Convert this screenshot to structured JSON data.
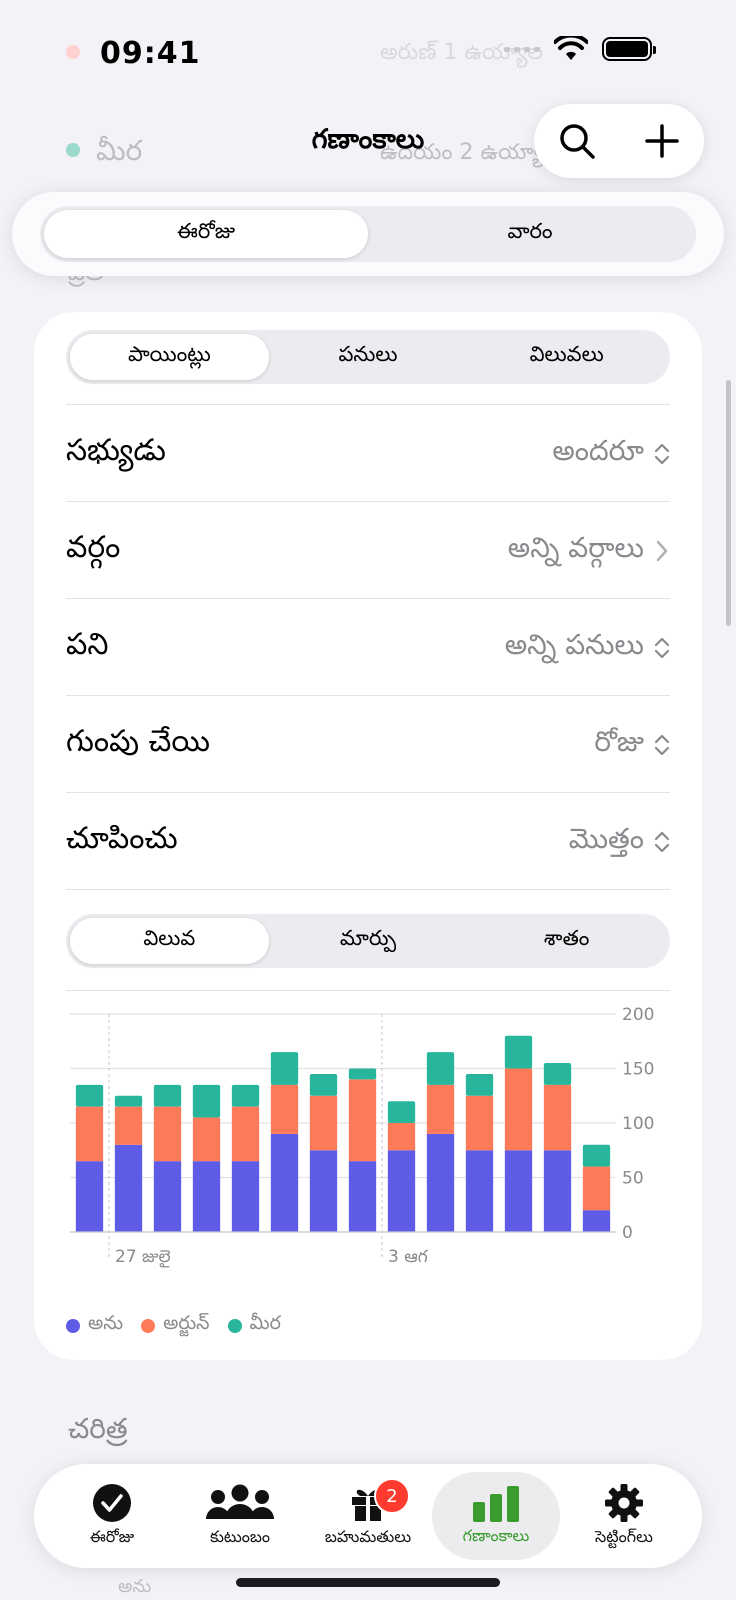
{
  "status": {
    "time": "09:41"
  },
  "background_list": {
    "row1_name": "అరుణ్ 1 ఉయ్యాల",
    "row2_name": "మీర",
    "row2_detail": "ఉదయం 2 ఉయ్యాల",
    "section_partial": "ప్రతి",
    "bottom_name": "అను"
  },
  "header": {
    "title": "గణాంకాలు",
    "search_icon": "search-icon",
    "add_icon": "plus-icon"
  },
  "period_tabs": [
    {
      "label": "ఈరోజు",
      "active": true
    },
    {
      "label": "వారం",
      "active": false
    }
  ],
  "metric_tabs": [
    {
      "label": "పాయింట్లు",
      "active": true
    },
    {
      "label": "పనులు",
      "active": false
    },
    {
      "label": "విలువలు",
      "active": false
    }
  ],
  "filters": [
    {
      "label": "సభ్యుడు",
      "value": "అందరూ",
      "control": "updown"
    },
    {
      "label": "వర్గం",
      "value": "అన్ని వర్గాలు",
      "control": "chevron"
    },
    {
      "label": "పని",
      "value": "అన్ని పనులు",
      "control": "updown"
    },
    {
      "label": "గుంపు చేయి",
      "value": "రోజు",
      "control": "updown"
    },
    {
      "label": "చూపించు",
      "value": "మొత్తం",
      "control": "updown"
    }
  ],
  "view_tabs": [
    {
      "label": "విలువ",
      "active": true
    },
    {
      "label": "మార్పు",
      "active": false
    },
    {
      "label": "శాతం",
      "active": false
    }
  ],
  "chart_data": {
    "type": "bar",
    "stacked": true,
    "categories": [
      "d1",
      "d2",
      "d3",
      "d4",
      "d5",
      "d6",
      "d7",
      "d8",
      "d9",
      "d10",
      "d11",
      "d12",
      "d13",
      "d14"
    ],
    "x_tick_labels": [
      {
        "index": 1,
        "label": "27 జులై"
      },
      {
        "index": 8,
        "label": "3 ఆగ"
      }
    ],
    "series": [
      {
        "name": "అను",
        "color": "#5e5ce6",
        "values": [
          65,
          80,
          65,
          65,
          65,
          90,
          75,
          65,
          75,
          90,
          75,
          75,
          75,
          20
        ]
      },
      {
        "name": "అర్జున్",
        "color": "#ff7a59",
        "values": [
          50,
          35,
          50,
          40,
          50,
          45,
          50,
          75,
          25,
          45,
          50,
          75,
          60,
          40
        ]
      },
      {
        "name": "మీర",
        "color": "#27b59b",
        "values": [
          20,
          10,
          20,
          30,
          20,
          30,
          20,
          10,
          20,
          30,
          20,
          30,
          20,
          20
        ]
      }
    ],
    "ylim": [
      0,
      200
    ],
    "yticks": [
      0,
      50,
      100,
      150,
      200
    ],
    "grid": true,
    "legend_position": "bottom-left"
  },
  "history": {
    "title": "చరిత్ర"
  },
  "tabbar": [
    {
      "label": "ఈరోజు",
      "icon": "checkmark-circle-icon",
      "active": false
    },
    {
      "label": "కుటుంబం",
      "icon": "people-icon",
      "active": false
    },
    {
      "label": "బహుమతులు",
      "icon": "gift-icon",
      "active": false,
      "badge": "2"
    },
    {
      "label": "గణాంకాలు",
      "icon": "bar-chart-icon",
      "active": true
    },
    {
      "label": "సెట్టింగ్‌లు",
      "icon": "gear-icon",
      "active": false
    }
  ]
}
